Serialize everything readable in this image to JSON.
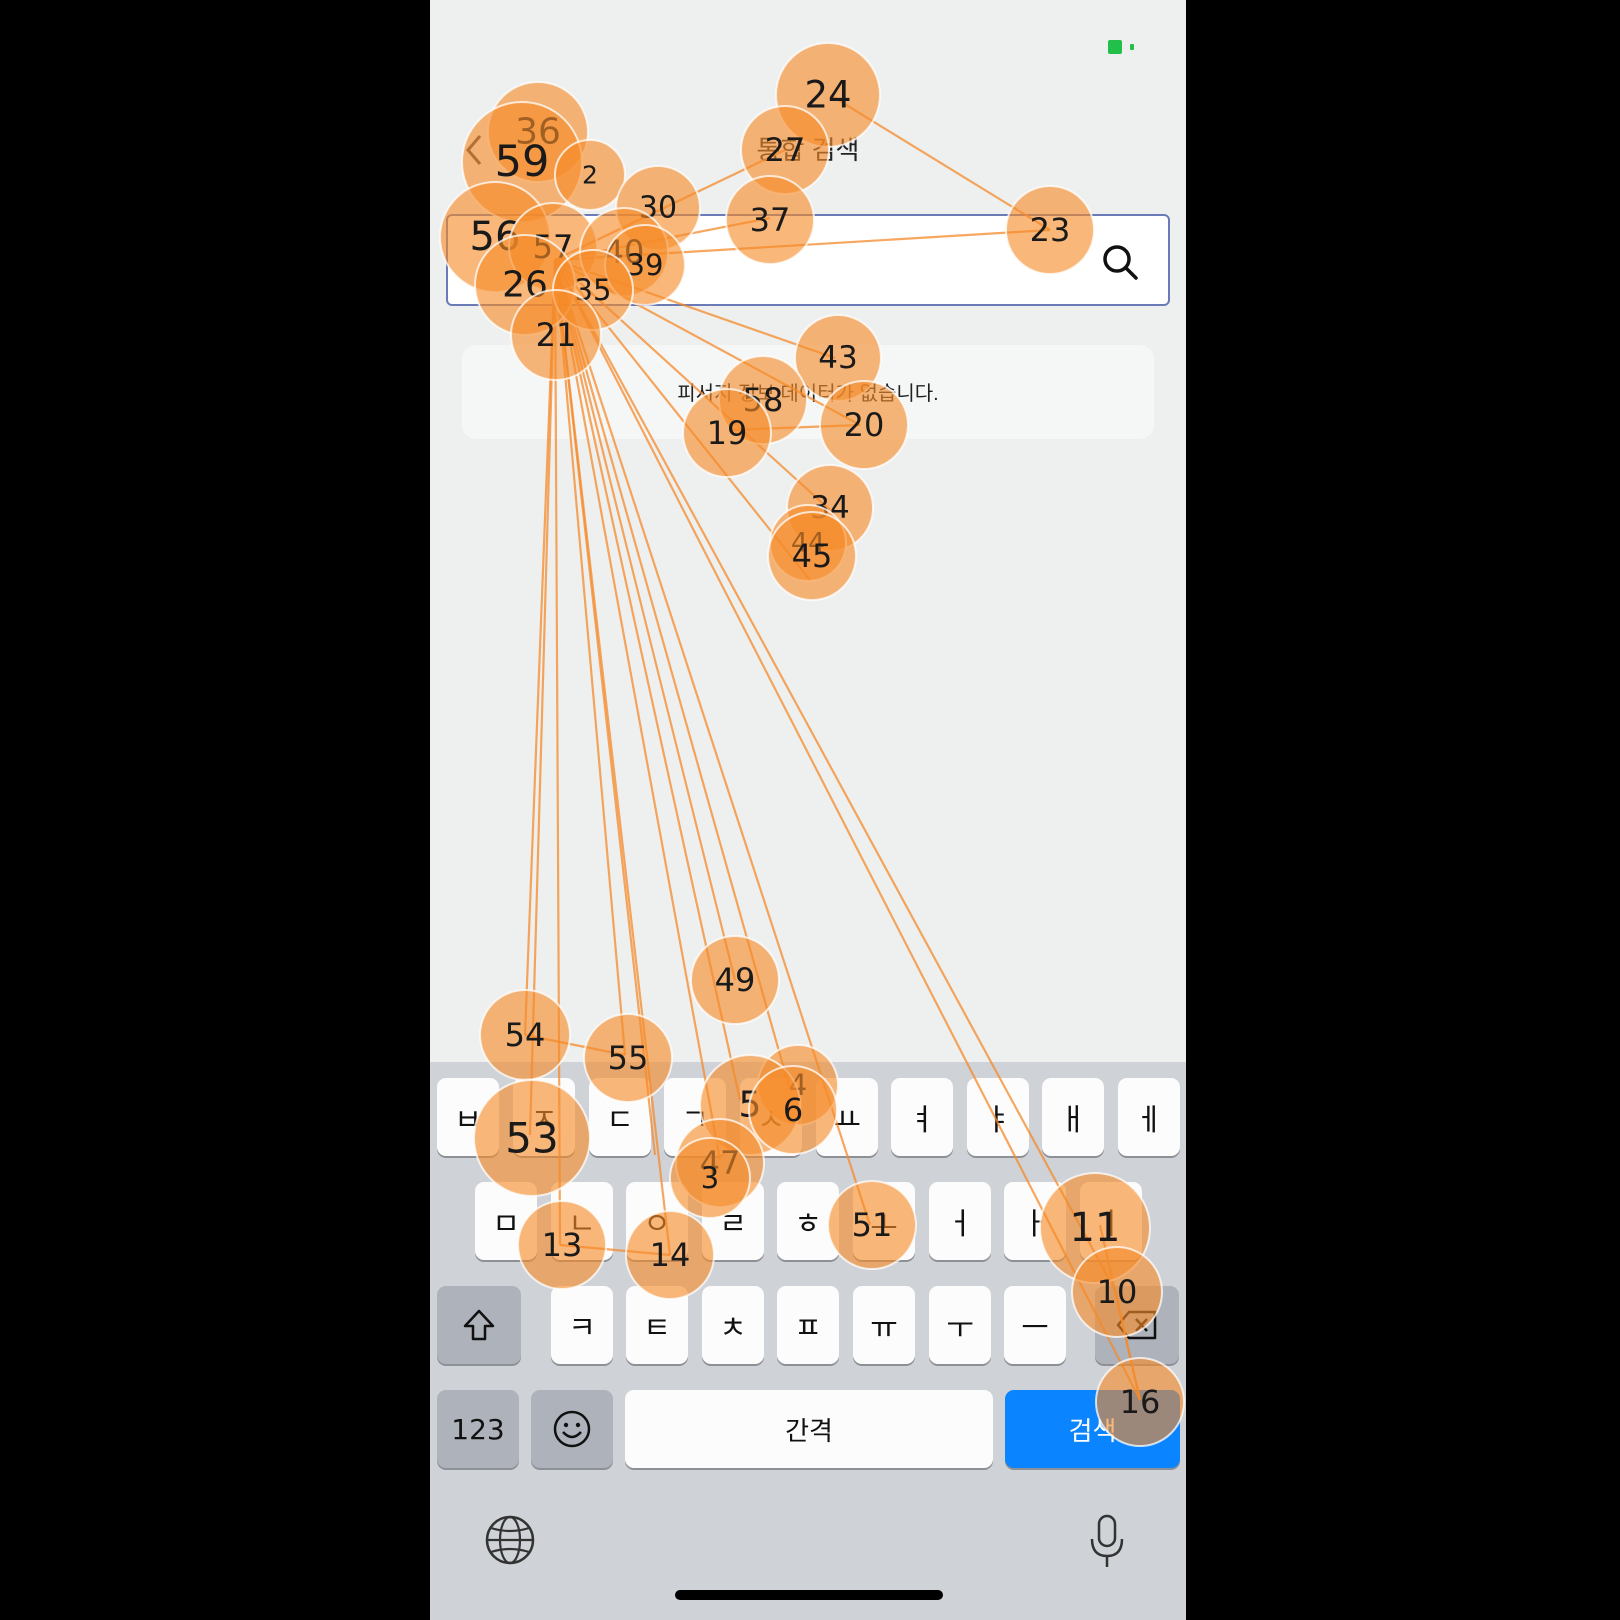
{
  "status": {
    "battery_color": "#22c04a"
  },
  "nav": {
    "back_icon": "chevron-left-icon",
    "title": "통합 검색"
  },
  "search": {
    "value": "",
    "placeholder": "",
    "icon": "search-icon"
  },
  "empty_state": {
    "message": "피서지 정보 데이터가 없습니다."
  },
  "keyboard": {
    "row1": [
      "ㅂ",
      "ㅈ",
      "ㄷ",
      "ㄱ",
      "ㅅ",
      "ㅛ",
      "ㅕ",
      "ㅑ",
      "ㅐ",
      "ㅔ"
    ],
    "row2": [
      "ㅁ",
      "ㄴ",
      "ㅇ",
      "ㄹ",
      "ㅎ",
      "ㅗ",
      "ㅓ",
      "ㅏ",
      "ㅣ"
    ],
    "row3": [
      "ㅋ",
      "ㅌ",
      "ㅊ",
      "ㅍ",
      "ㅠ",
      "ㅜ",
      "ㅡ"
    ],
    "shift_icon": "shift-icon",
    "backspace_icon": "backspace-icon",
    "numbers_label": "123",
    "emoji_icon": "emoji-icon",
    "space_label": "간격",
    "search_label": "검색",
    "globe_icon": "globe-icon",
    "mic_icon": "microphone-icon",
    "accent_color": "#0a84ff"
  },
  "tap_overlay": {
    "color": "#f58b28",
    "markers": [
      {
        "label": "24"
      },
      {
        "label": "27"
      },
      {
        "label": "36"
      },
      {
        "label": "59"
      },
      {
        "label": "2"
      },
      {
        "label": "30"
      },
      {
        "label": "37"
      },
      {
        "label": "23"
      },
      {
        "label": "56"
      },
      {
        "label": "57"
      },
      {
        "label": "40"
      },
      {
        "label": "39"
      },
      {
        "label": "26"
      },
      {
        "label": "35"
      },
      {
        "label": "21"
      },
      {
        "label": "43"
      },
      {
        "label": "58"
      },
      {
        "label": "19"
      },
      {
        "label": "20"
      },
      {
        "label": "34"
      },
      {
        "label": "44"
      },
      {
        "label": "45"
      },
      {
        "label": "49"
      },
      {
        "label": "54"
      },
      {
        "label": "55"
      },
      {
        "label": "4"
      },
      {
        "label": "5"
      },
      {
        "label": "6"
      },
      {
        "label": "53"
      },
      {
        "label": "47"
      },
      {
        "label": "3"
      },
      {
        "label": "51"
      },
      {
        "label": "11"
      },
      {
        "label": "13"
      },
      {
        "label": "14"
      },
      {
        "label": "10"
      },
      {
        "label": "16"
      }
    ]
  }
}
